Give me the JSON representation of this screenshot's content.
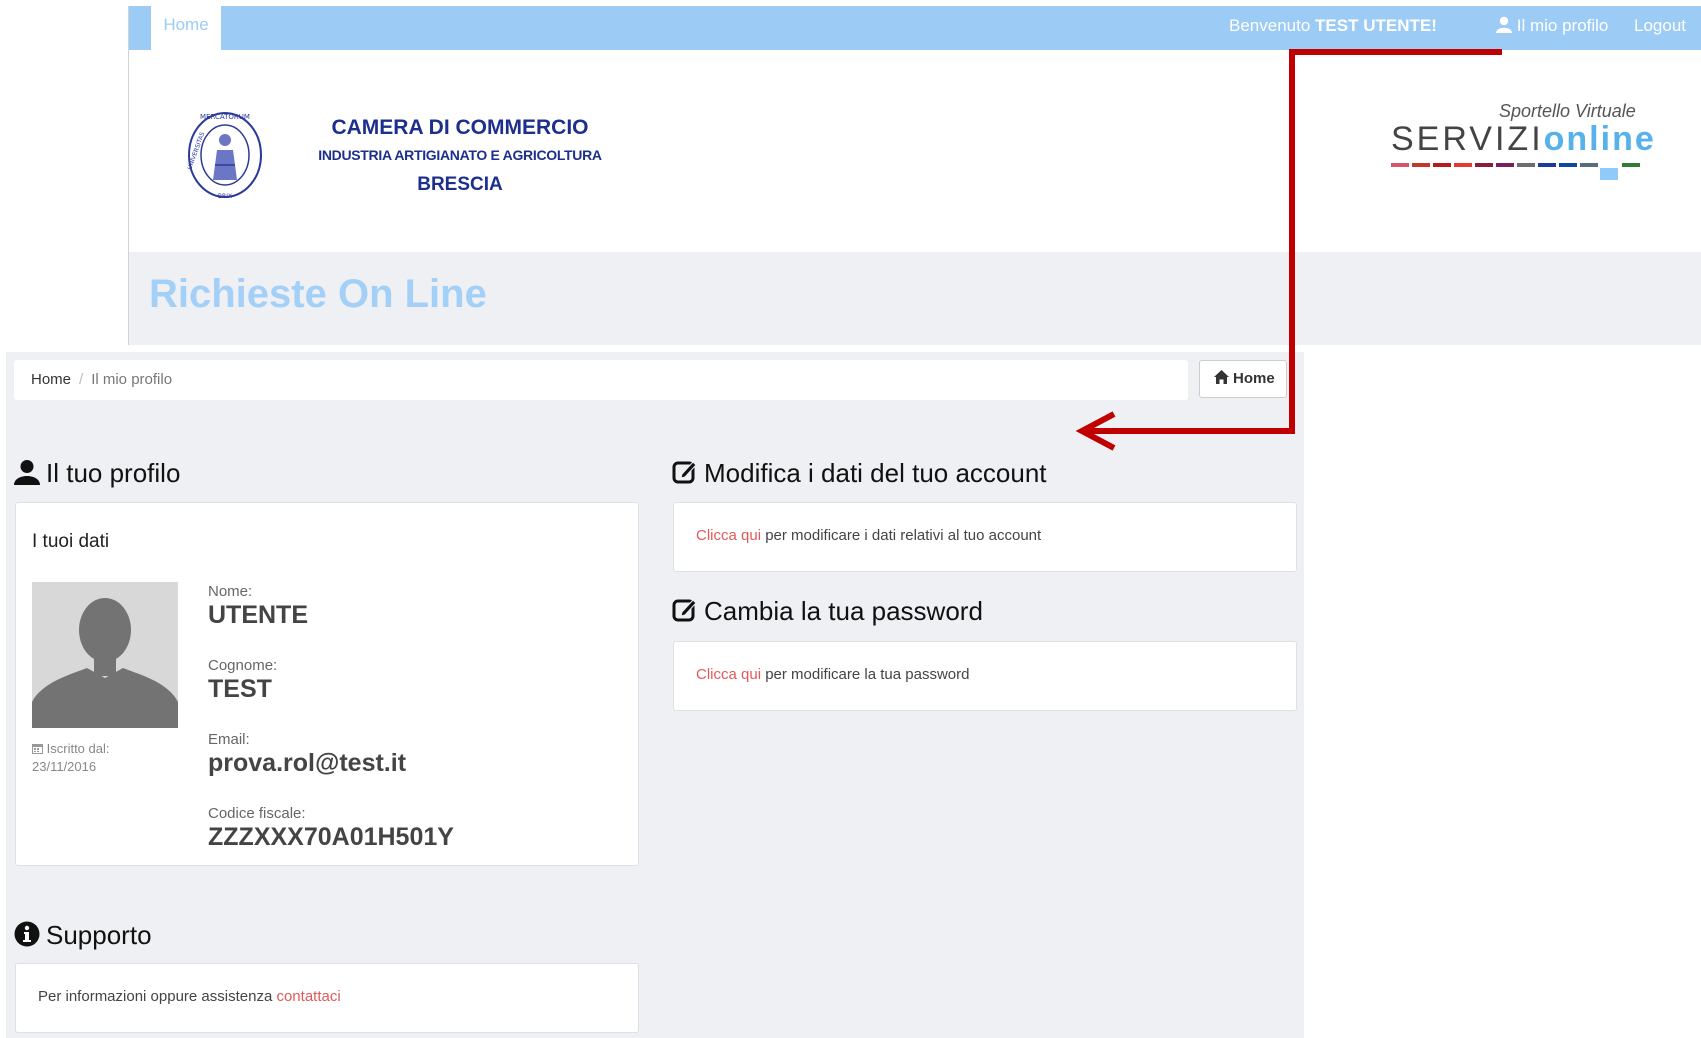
{
  "navbar": {
    "home_tab": "Home",
    "welcome_prefix": "Benvenuto",
    "welcome_user": "TEST UTENTE!",
    "profile_link": "Il mio profilo",
    "logout_link": "Logout",
    "bg_color": "#9ccbf6"
  },
  "header": {
    "org_line1": "CAMERA DI COMMERCIO",
    "org_line2": "INDUSTRIA ARTIGIANATO E AGRICOLTURA",
    "org_line3": "BRESCIA",
    "seal_text": "UNIVERSITAS MERCATORUM BRIX",
    "brand_subtitle": "Sportello Virtuale",
    "brand_main_a": "SERVIZI",
    "brand_main_b": "online",
    "page_title": "Richieste On Line"
  },
  "breadcrumb": {
    "home": "Home",
    "separator": "/",
    "current": "Il mio profilo",
    "home_button": "Home"
  },
  "profile": {
    "section_title": "Il tuo profilo",
    "card_title": "I tuoi dati",
    "registered_label": "Iscritto dal:",
    "registered_date": "23/11/2016",
    "fields": [
      {
        "label": "Nome:",
        "value": "UTENTE"
      },
      {
        "label": "Cognome:",
        "value": "TEST"
      },
      {
        "label": "Email:",
        "value": "prova.rol@test.it"
      },
      {
        "label": "Codice fiscale:",
        "value": "ZZZXXX70A01H501Y"
      }
    ]
  },
  "account": {
    "section_title": "Modifica i dati del tuo account",
    "link_text": "Clicca qui",
    "rest_text": " per modificare i dati relativi al tuo account"
  },
  "password": {
    "section_title": "Cambia la tua password",
    "link_text": "Clicca qui",
    "rest_text": " per modificare la tua password"
  },
  "support": {
    "section_title": "Supporto",
    "text": "Per informazioni oppure assistenza ",
    "link_text": "contattaci"
  },
  "colors": {
    "link": "#e05a5a",
    "annotation_arrow": "#c00000",
    "title_blue": "#a4d0f8"
  }
}
